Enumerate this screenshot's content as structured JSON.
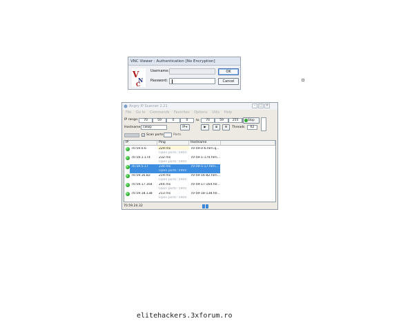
{
  "vnc_dialog": {
    "title": "VNC Viewer : Authentication [No Encryption]",
    "username_label": "Username:",
    "password_label": "Password:",
    "username_value": "",
    "password_value": "",
    "ok_label": "OK",
    "cancel_label": "Cancel",
    "logo_text": "VNC"
  },
  "ip_scanner": {
    "title": "Angry IP Scanner 2.21",
    "menu": [
      "File",
      "Go to",
      "Commands",
      "Favorites",
      "Options",
      "Utils",
      "Help"
    ],
    "ip_range_label": "IP range:",
    "to_label": "to",
    "ip_from": [
      "70",
      "59",
      "0",
      "0"
    ],
    "ip_to": [
      "70",
      "59",
      "255",
      "255"
    ],
    "stop_label": "Stop",
    "hostname_label": "Hostname:",
    "hostname_value": "cwwp",
    "threads_label": "Threads",
    "threads_value": "62",
    "scan_ports_label": "Scan ports",
    "ports_label": "Ports",
    "ip_button": "IP",
    "columns": [
      "IP",
      "Ping",
      "Hostname"
    ],
    "rows": [
      {
        "ip": "70.59.0.6",
        "ping": "229 ms",
        "ports": "Open ports: 5900",
        "hostname": "70-59-0-6.hlrn.q..."
      },
      {
        "ip": "70.59.1.174",
        "ping": "232 ms",
        "ports": "Open ports: 5900",
        "hostname": "70-59-1-174.hlrn..."
      },
      {
        "ip": "70.59.5.17",
        "ping": "230 ms",
        "ports": "Open ports: 5900",
        "hostname": "70-59-5-17.hlrn..."
      },
      {
        "ip": "70.59.16.82",
        "ping": "219 ms",
        "ports": "Open ports: 5900",
        "hostname": "70-59-16-82.hlrn..."
      },
      {
        "ip": "70.59.17.164",
        "ping": "244 ms",
        "ports": "Open ports: 5900",
        "hostname": "70-59-17-164.hlr..."
      },
      {
        "ip": "70.59.18.138",
        "ping": "213 ms",
        "ports": "Open ports: 5900",
        "hostname": "70-59-18-138.hlr..."
      }
    ],
    "selected_row": 2,
    "status_ip": "70.59.24.32"
  },
  "watermark": "elitehackers.3xforum.ro",
  "colors": {
    "selection": "#3d8ee0",
    "ping_bg": "#fdf8d9",
    "alive": "#1a9c1a",
    "progress": "#3b86d6"
  }
}
